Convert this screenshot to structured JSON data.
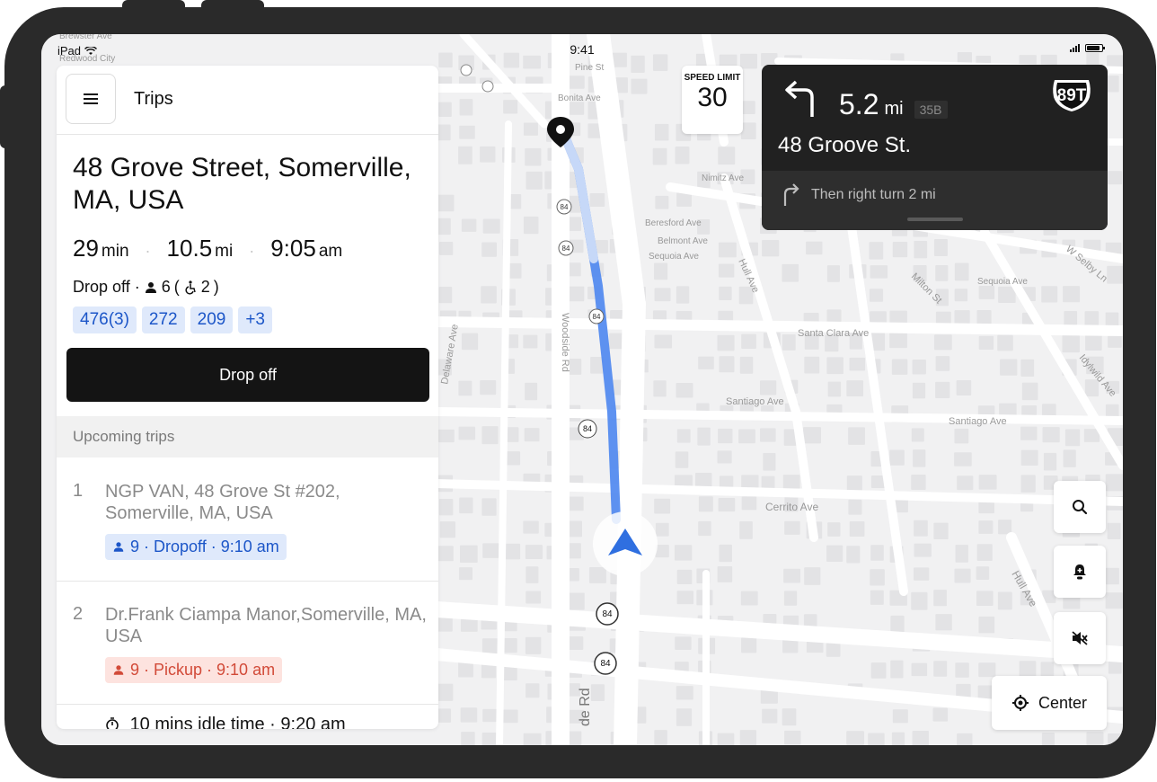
{
  "status_bar": {
    "device": "iPad",
    "time": "9:41"
  },
  "panel": {
    "title": "Trips",
    "destination": "48 Grove Street, Somerville, MA, USA",
    "eta": {
      "duration": "29",
      "duration_unit": "min",
      "distance": "10.5",
      "distance_unit": "mi",
      "arrival": "9:05",
      "arrival_unit": "am"
    },
    "dropoff_summary": {
      "label": "Drop off ·",
      "riders": "6",
      "wheelchair": "2"
    },
    "chips": [
      "476(3)",
      "272",
      "209",
      "+3"
    ],
    "primary_button": "Drop off",
    "upcoming_header": "Upcoming trips",
    "trips": [
      {
        "num": "1",
        "address": "NGP VAN, 48 Grove St #202, Somerville, MA, USA",
        "badge": "9 · Dropoff · 9:10 am",
        "kind": "dropoff"
      },
      {
        "num": "2",
        "address": "Dr.Frank Ciampa Manor,Somerville, MA, USA",
        "badge": "9 · Pickup · 9:10 am",
        "kind": "pickup"
      }
    ],
    "idle_text": "10 mins idle time · 9:20 am"
  },
  "speed_limit": {
    "label": "SPEED LIMIT",
    "value": "30"
  },
  "navigation": {
    "distance": "5.2",
    "unit": "mi",
    "exit": "35B",
    "street": "48 Groove St.",
    "then": "Then right turn 2 mi",
    "highway_shield": "89T"
  },
  "map_labels": {
    "streets": [
      "Woodside Rd",
      "Delaware Ave",
      "Santa Clara Ave",
      "Santiago Ave",
      "Santiago Ave",
      "Cerrito Ave",
      "Hull Ave",
      "Hull Ave",
      "Milton St",
      "Sequoia Ave",
      "Sequoia Ave",
      "Beresford Ave",
      "Belmont Ave",
      "Nimitz Ave",
      "Idylwild Ave",
      "W Selby Ln",
      "Bonita Ave",
      "Pine St",
      "Redwood City",
      "Brewster Ave",
      "de Rd"
    ],
    "route_badge": "84"
  },
  "controls": {
    "center_label": "Center"
  },
  "colors": {
    "route": "#4c86f0",
    "chip_bg": "#dfe9fb",
    "chip_text": "#1c56c8",
    "pickup_bg": "#fde3df",
    "pickup_text": "#d24a38",
    "nav_bg": "#212121"
  }
}
